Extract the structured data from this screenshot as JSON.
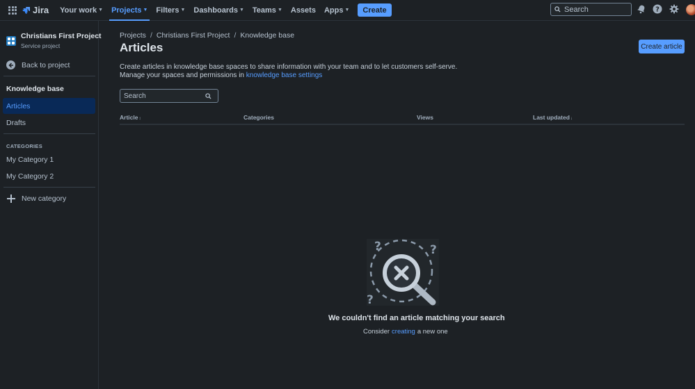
{
  "topnav": {
    "logo_text": "Jira",
    "items": [
      {
        "label": "Your work",
        "dropdown": true
      },
      {
        "label": "Projects",
        "dropdown": true,
        "active": true
      },
      {
        "label": "Filters",
        "dropdown": true
      },
      {
        "label": "Dashboards",
        "dropdown": true
      },
      {
        "label": "Teams",
        "dropdown": true
      },
      {
        "label": "Assets",
        "dropdown": false
      },
      {
        "label": "Apps",
        "dropdown": true
      }
    ],
    "create_label": "Create",
    "search_placeholder": "Search",
    "icons": [
      "apps-grid-icon",
      "jira-logo",
      "notifications-icon",
      "help-icon",
      "settings-icon",
      "avatar"
    ]
  },
  "sidebar": {
    "project_name": "Christians First Project",
    "project_type": "Service project",
    "back_label": "Back to project",
    "kb_heading": "Knowledge base",
    "items": [
      {
        "label": "Articles",
        "selected": true
      },
      {
        "label": "Drafts",
        "selected": false
      }
    ],
    "categories_label": "CATEGORIES",
    "categories": [
      "My Category 1",
      "My Category 2"
    ],
    "new_category_label": "New category"
  },
  "main": {
    "breadcrumbs": [
      "Projects",
      "Christians First Project",
      "Knowledge base"
    ],
    "title": "Articles",
    "create_article_label": "Create article",
    "desc_line1": "Create articles in knowledge base spaces to share information with your team and to let customers self-serve.",
    "desc_line2_prefix": "Manage your spaces and permissions in ",
    "desc_link": "knowledge base settings",
    "search_placeholder": "Search",
    "columns": [
      {
        "label": "Article",
        "sort": "↕"
      },
      {
        "label": "Categories",
        "sort": ""
      },
      {
        "label": "Views",
        "sort": ""
      },
      {
        "label": "Last updated",
        "sort": "↓"
      }
    ],
    "empty": {
      "title": "We couldn't find an article matching your search",
      "sub_prefix": "Consider",
      "sub_link": "creating",
      "sub_suffix": "a new one"
    }
  },
  "colors": {
    "background": "#1d2125",
    "accent": "#579dff",
    "selected_bg": "#092957",
    "text": "#c7d1db"
  }
}
